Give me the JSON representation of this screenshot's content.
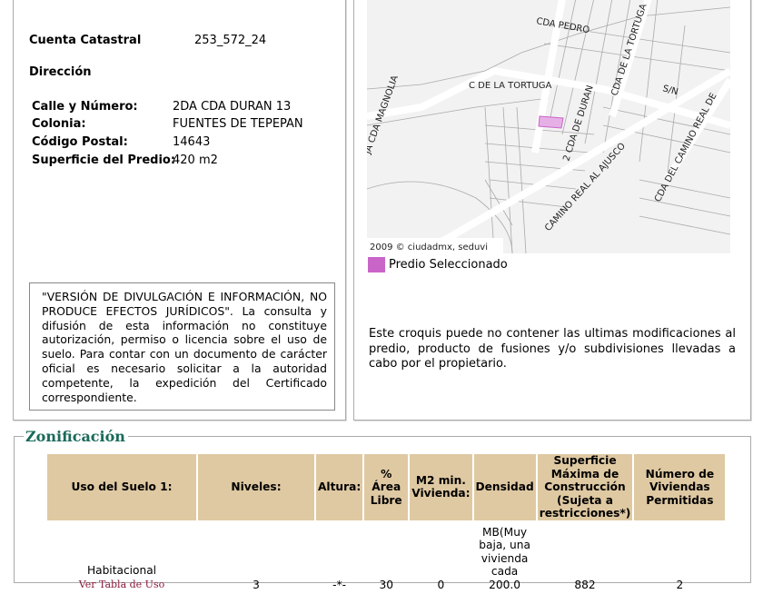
{
  "predio": {
    "cuenta_label": "Cuenta Catastral",
    "cuenta_value": "253_572_24",
    "direccion_label": "Dirección",
    "calle_label": "Calle y Número:",
    "calle_value": "2DA CDA DURAN 13",
    "colonia_label": "Colonia:",
    "colonia_value": "FUENTES DE TEPEPAN",
    "cp_label": "Código Postal:",
    "cp_value": "14643",
    "superficie_label": "Superficie del Predio:",
    "superficie_value": "420 m2",
    "disclaimer": "\"VERSIÓN DE DIVULGACIÓN E INFORMACIÓN, NO PRODUCE EFECTOS JURÍDICOS\". La consulta y difusión de esta información no constituye autorización, permiso o licencia sobre el uso de suelo. Para contar con un documento de carácter oficial es necesario solicitar a la autoridad competente, la expedición del Certificado correspondiente."
  },
  "map": {
    "streets": [
      "CDA PEDRO",
      "C DE LA TORTUGA",
      "CDA DE LA TORTUGA",
      "S/N",
      "JA CDA MAGNOLIA",
      "2 CDA DE DURAN",
      "CAMINO REAL AL AJUSCO",
      "CDA DEL CAMINO REAL DE"
    ],
    "copyright": "2009 © ciudadmx, seduvi",
    "legend": "Predio Seleccionado",
    "selected_color": "#c965c9",
    "note": "Este croquis puede no contener las ultimas modificaciones al predio, producto de fusiones y/o subdivisiones llevadas a cabo por el propietario."
  },
  "zonificacion": {
    "title": "Zonificación",
    "headers": [
      "Uso del Suelo 1:",
      "Niveles:",
      "Altura:",
      "% Área Libre",
      "M2 min. Vivienda:",
      "Densidad",
      "Superficie Máxima de Construcción (Sujeta a restricciones*)",
      "Número de Viviendas Permitidas"
    ],
    "row": {
      "uso": "Habitacional",
      "uso_link": "Ver Tabla de Uso",
      "niveles": "3",
      "altura": "-*-",
      "area_libre": "30",
      "m2_min": "0",
      "densidad": "MB(Muy baja, una vivienda cada 200.0",
      "superficie": "882",
      "viviendas": "2"
    }
  }
}
